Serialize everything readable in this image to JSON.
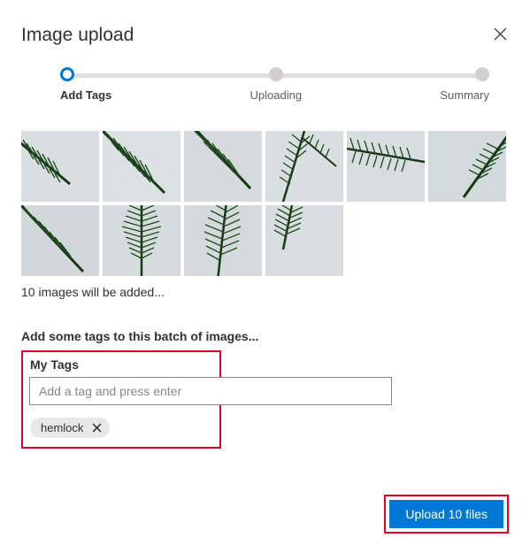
{
  "dialog": {
    "title": "Image upload",
    "close_name": "close-icon"
  },
  "stepper": {
    "steps": [
      {
        "label": "Add Tags",
        "active": true
      },
      {
        "label": "Uploading",
        "active": false
      },
      {
        "label": "Summary",
        "active": false
      }
    ]
  },
  "thumbnails": {
    "count": 10,
    "status_text": "10 images will be added..."
  },
  "tag_prompt": "Add some tags to this batch of images...",
  "tags": {
    "section_title": "My Tags",
    "input_placeholder": "Add a tag and press enter",
    "chips": [
      {
        "label": "hemlock"
      }
    ]
  },
  "footer": {
    "upload_label": "Upload 10 files"
  },
  "colors": {
    "accent": "#0078d4",
    "highlight": "#e3002b"
  }
}
